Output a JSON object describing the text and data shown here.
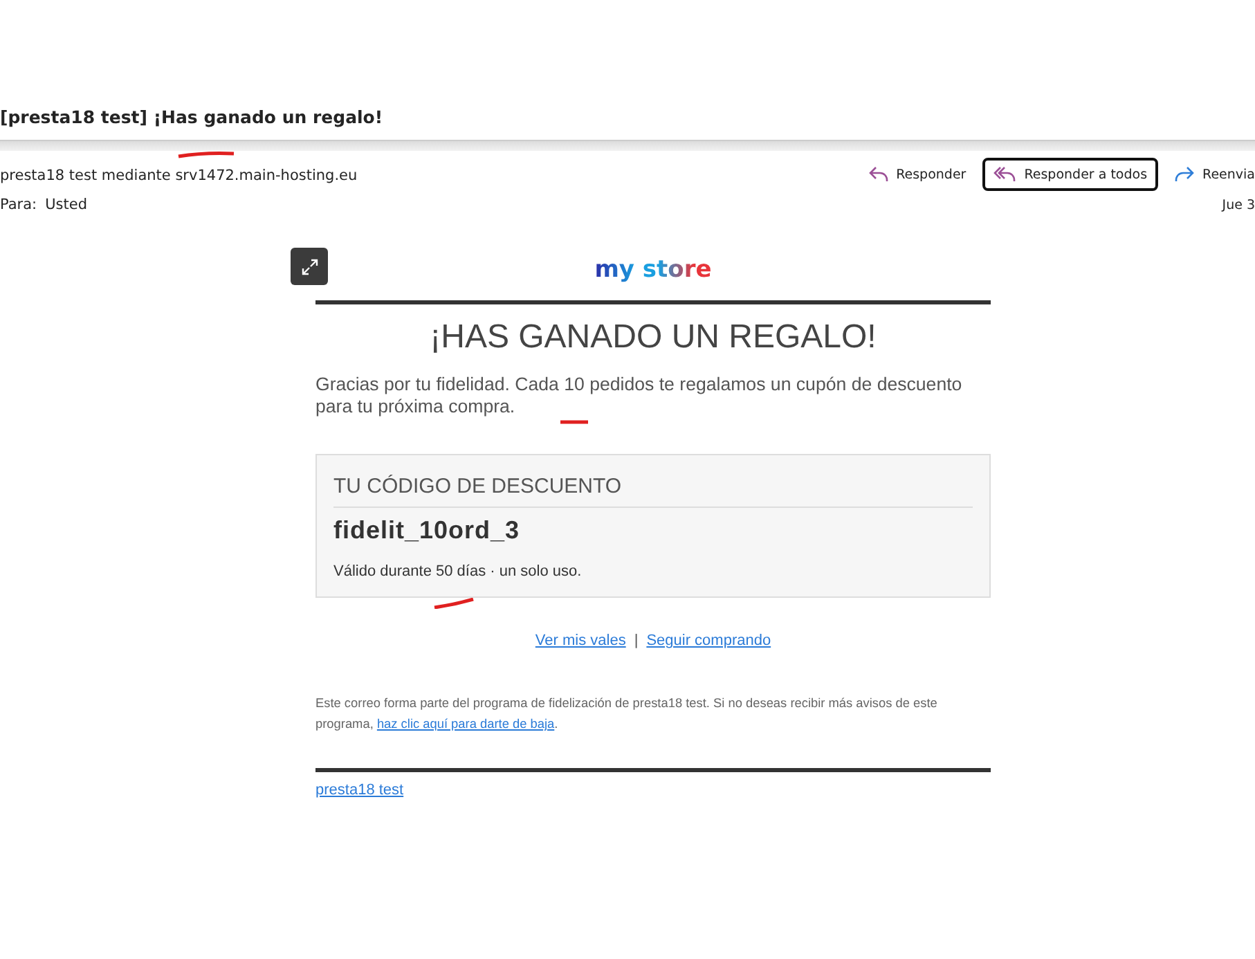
{
  "subject": "[presta18 test] ¡Has ganado un regalo!",
  "sender": "presta18 test mediante srv1472.main-hosting.eu",
  "to_label": "Para:",
  "to": "Usted",
  "actions": [
    {
      "kind": "reply",
      "label": "Responder",
      "selected": false
    },
    {
      "kind": "reply_all",
      "label": "Responder a todos",
      "selected": true
    },
    {
      "kind": "forward",
      "label": "Reenvia",
      "selected": false
    }
  ],
  "date": "Jue 3",
  "email": {
    "logo": "my store",
    "heading": "¡HAS GANADO UN REGALO!",
    "intro": "Gracias por tu fidelidad. Cada 10 pedidos te regalamos un cupón de descuento para tu próxima compra.",
    "coupon": {
      "title": "TU CÓDIGO DE DESCUENTO",
      "code": "fidelit_10ord_3",
      "validity": "Válido durante 50 días · un solo uso."
    },
    "links": [
      "Ver mis vales",
      "Seguir comprando"
    ],
    "link_separator": "|",
    "footer_text": "Este correo forma parte del programa de fidelización de presta18 test. Si no deseas recibir más avisos de este programa,",
    "footer_link": "haz clic aquí para darte de baja",
    "footer_end": ".",
    "shop_link": "presta18 test"
  }
}
